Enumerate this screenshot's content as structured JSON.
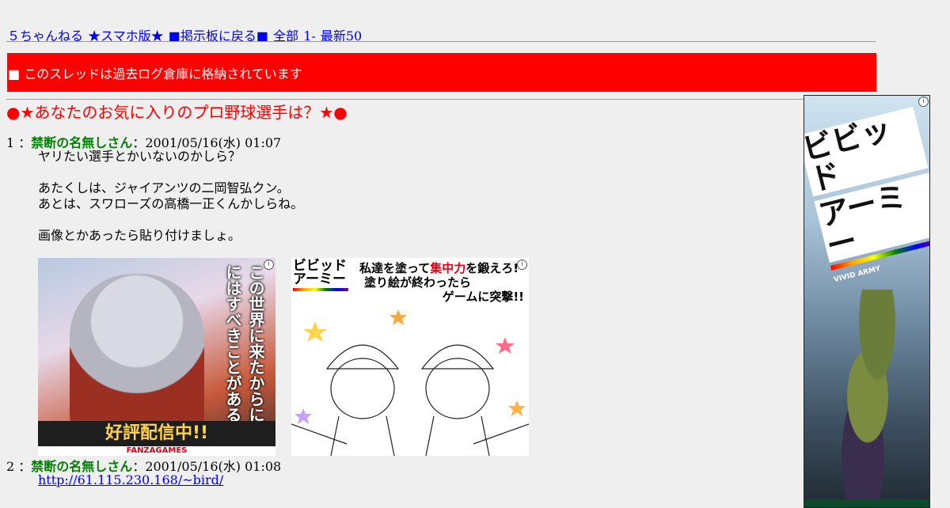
{
  "nav": {
    "board": "５ちゃんねる",
    "smartphone": "★スマホ版★",
    "back": "■掲示板に戻る■",
    "all": "全部",
    "first": "1-",
    "latest": "最新50"
  },
  "banner": {
    "text": "■ このスレッドは過去ログ倉庫に格納されています"
  },
  "thread": {
    "title": "●★あなたのお気に入りのプロ野球選手は？★●"
  },
  "posts": [
    {
      "number": "1",
      "separator": "：",
      "name": "禁断の名無しさん",
      "date": "：2001/05/16(水) 01:07",
      "lines": [
        "ヤリたい選手とかいないのかしら？",
        "あたくしは、ジャイアンツの二岡智弘クン。",
        "あとは、スワローズの高橋一正くんかしらね。",
        "画像とかあったら貼り付けましょ。"
      ]
    },
    {
      "number": "2",
      "separator": "：",
      "name": "禁断の名無しさん",
      "date": "：2001/05/16(水) 01:08",
      "link": "http://61.115.230.168/~bird/"
    }
  ],
  "ads": {
    "ad_a": {
      "vertical_copy": "この世界に来たからには君にはすべきことがある",
      "cta": "好評配信中!!",
      "maker": "FANZAGAMES"
    },
    "ad_b": {
      "logo_line1": "ビビッド",
      "logo_line2": "アーミー",
      "copy_part1": "私達を塗って",
      "copy_highlight": "集中力",
      "copy_part2": "を鍛えろ!",
      "copy_line2": "塗り絵が終わったら",
      "copy_line3": "ゲームに突撃!!"
    },
    "side": {
      "title_line1": "ビビッド",
      "title_line2": "アーミー",
      "sub": "VIVID ARMY"
    },
    "info_icon": "i"
  }
}
